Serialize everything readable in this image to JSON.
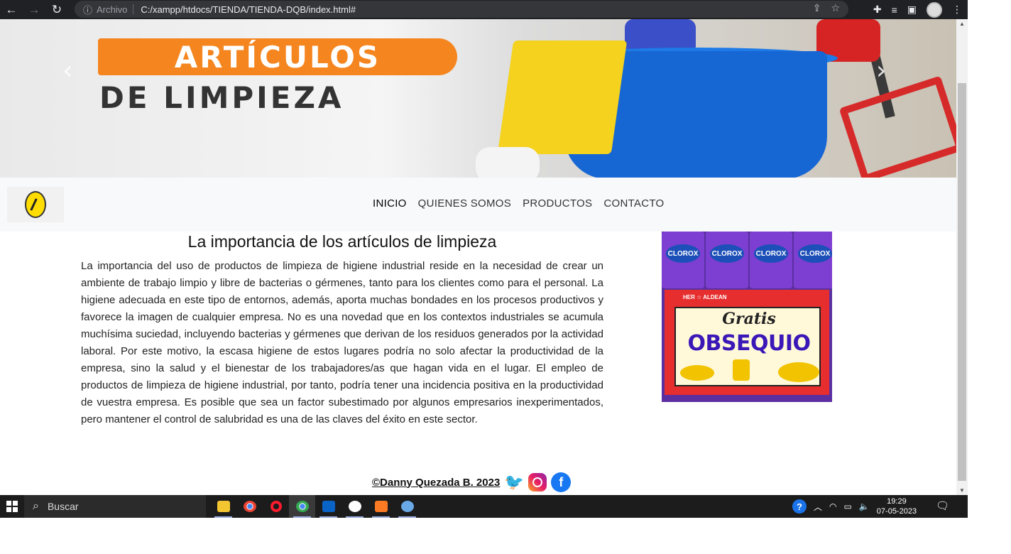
{
  "browser": {
    "back": "←",
    "forward": "→",
    "reload": "↻",
    "info_icon": "ⓘ",
    "scheme_label": "Archivo",
    "url": "C:/xampp/htdocs/TIENDA/TIENDA-DQB/index.html#"
  },
  "banner": {
    "title_line1": "ARTÍCULOS",
    "title_line2": "DE LIMPIEZA",
    "prev": "‹",
    "next": "›"
  },
  "nav": {
    "items": [
      {
        "label": "INICIO",
        "active": true
      },
      {
        "label": "QUIENES SOMOS"
      },
      {
        "label": "PRODUCTOS"
      },
      {
        "label": "CONTACTO"
      }
    ]
  },
  "article": {
    "title": "La importancia de los artículos de limpieza",
    "body": "La importancia del uso de productos de limpieza de higiene industrial reside en la necesidad de crear un ambiente de trabajo limpio y libre de bacterias o gérmenes, tanto para los clientes como para el personal. La higiene adecuada en este tipo de entornos, además, aporta muchas bondades en los procesos productivos y favorece la imagen de cualquier empresa. No es una novedad que en los contextos industriales se acumula muchísima suciedad, incluyendo bacterias y gérmenes que derivan de los residuos generados por la actividad laboral. Por este motivo, la escasa higiene de estos lugares podría no solo afectar la productividad de la empresa, sino la salud y el bienestar de los trabajadores/as que hagan vida en el lugar. El empleo de productos de limpieza de higiene industrial, por tanto, podría tener una incidencia positiva en la productividad de vuestra empresa. Es posible que sea un factor subestimado por algunos empresarios inexperimentados, pero mantener el control de salubridad es una de las claves del éxito en este sector."
  },
  "promo": {
    "pack_brand": "CLOROX",
    "store_brand": "HER ☆ ALDEAN",
    "gratis": "Gratis",
    "obsequio": "OBSEQUIO"
  },
  "footer": {
    "credit": "©Danny Quezada B. 2023",
    "facebook_glyph": "f"
  },
  "taskbar": {
    "search_placeholder": "Buscar",
    "help": "?",
    "time": "19:29",
    "date": "07-05-2023"
  },
  "colors": {
    "browser_bar": "#202124",
    "accent_orange": "#f5851f",
    "navbar_bg": "#f8f9fa",
    "obsequio": "#3a18b8"
  },
  "icons": [
    "back-icon",
    "forward-icon",
    "reload-icon",
    "info-icon",
    "share-icon",
    "star-icon",
    "extensions-icon",
    "reading-list-icon",
    "sidebar-icon",
    "profile-avatar",
    "menu-icon",
    "twitter-icon",
    "instagram-icon",
    "facebook-icon",
    "windows-start-icon",
    "search-icon",
    "file-explorer-icon",
    "chrome-icon",
    "opera-icon",
    "outlook-icon",
    "github-icon",
    "xampp-icon",
    "help-icon",
    "wifi-icon",
    "battery-icon",
    "volume-icon",
    "notification-icon"
  ]
}
